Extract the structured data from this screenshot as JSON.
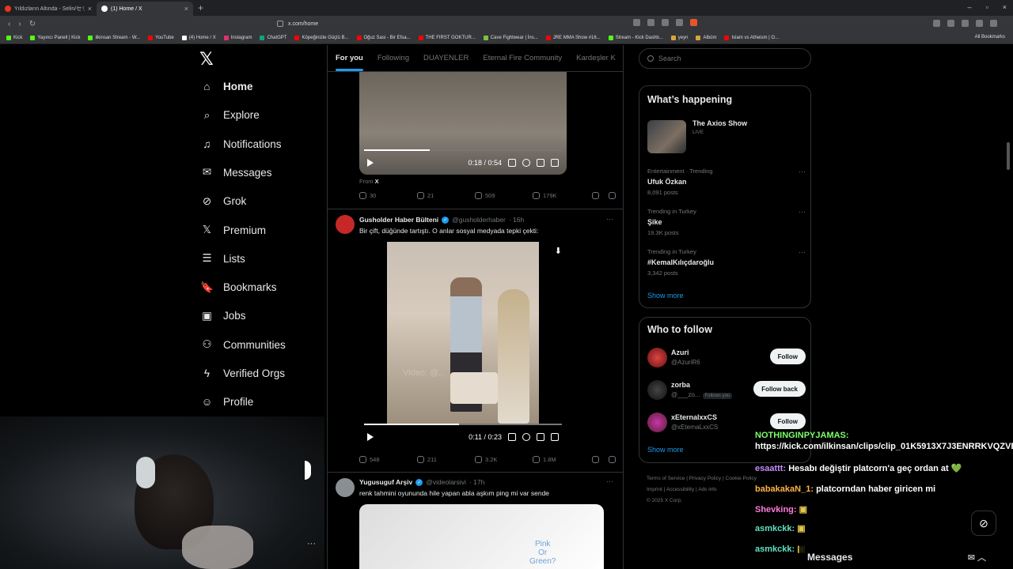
{
  "browser": {
    "tabs": [
      {
        "title": "Yıldızların Altında - Selin/セリン (cove...",
        "active": false
      },
      {
        "title": "(1) Home / X",
        "active": true
      }
    ],
    "url": "x.com/home",
    "bookmarks": [
      "Kick",
      "Yayıncı Paneli | Kick",
      "ilkinsan Stream - W...",
      "YouTube",
      "(4) Home / X",
      "Instagram",
      "ChatGPT",
      "Köpeğinizle Güçlü B...",
      "Oğuz Sasi - Bir Efsa...",
      "THE FIRST GOKTUR...",
      "Cave Fightwear | İns...",
      "JRE MMA Show #16...",
      "Stream - Kick Dashb...",
      "yeyn",
      "Albüm",
      "Islam vs Atheism | O..."
    ],
    "all_bookmarks": "All Bookmarks"
  },
  "nav": {
    "items": [
      "Home",
      "Explore",
      "Notifications",
      "Messages",
      "Grok",
      "Premium",
      "Lists",
      "Bookmarks",
      "Jobs",
      "Communities",
      "Verified Orgs",
      "Profile"
    ]
  },
  "feed": {
    "tabs": [
      "For you",
      "Following",
      "DUAYENLER",
      "Eternal Fire Community",
      "Kardeşler K"
    ],
    "tweet1": {
      "video_time": "0:18 / 0:54",
      "video_progress": 0.33,
      "from_label": "From",
      "from_source": "X",
      "replies": "30",
      "reposts": "21",
      "likes": "509",
      "views": "179K"
    },
    "tweet2": {
      "name": "Gusholder Haber Bülteni",
      "handle": "@gusholderhaber",
      "time": "· 16h",
      "text": "Bir çift, düğünde tartıştı. O anlar sosyal medyada tepki çekti:",
      "video_time": "0:11 / 0:23",
      "video_progress": 0.48,
      "watermark": "Video: @...",
      "replies": "548",
      "reposts": "211",
      "likes": "3.2K",
      "views": "1.8M"
    },
    "tweet3": {
      "name": "Yugusuguf Arşiv",
      "handle": "@videolarsivi",
      "time": "· 17h",
      "text": "renk tahmini oyununda hile yapan abla aşkım ping mi var sende",
      "overlay": "Pink\nOr\nGreen?"
    }
  },
  "right": {
    "search_placeholder": "Search",
    "happening_title": "What’s happening",
    "live": {
      "name": "The Axios Show",
      "status": "LIVE"
    },
    "trends": [
      {
        "meta": "Entertainment · Trending",
        "name": "Ufuk Özkan",
        "count": "8,091 posts"
      },
      {
        "meta": "Trending in Turkey",
        "name": "Şike",
        "count": "19.3K posts"
      },
      {
        "meta": "Trending in Turkey",
        "name": "#KemalKılıçdaroğlu",
        "count": "3,342 posts"
      }
    ],
    "show_more": "Show more",
    "who_title": "Who to follow",
    "who": [
      {
        "name": "Azuri",
        "handle": "@AzuriR6",
        "button": "Follow",
        "follows_you": ""
      },
      {
        "name": "zorba",
        "handle": "@___zo...",
        "button": "Follow back",
        "follows_you": "Follows you"
      },
      {
        "name": "xEternalxxCS",
        "handle": "@xEternaLxxCS",
        "button": "Follow",
        "follows_you": ""
      }
    ],
    "footer": [
      "Terms of Service",
      "Privacy Policy",
      "Cookie Policy",
      "Imprint",
      "Accessibility",
      "Ads info",
      "© 2025 X Corp."
    ]
  },
  "chat": [
    {
      "user": "NOTHINGINPYJAMAS:",
      "msg": "https://kick.com/ilkinsan/clips/clip_01K5913X7J3ENRRKVQZVB2XA13",
      "color": "#7dff6b"
    },
    {
      "user": "esaattt:",
      "msg": "Hesabı değiştir platcorn'a geç ordan at 💚",
      "color": "#c38cff"
    },
    {
      "user": "babakakaN_1:",
      "msg": "platcorndan haber giricen mi",
      "color": "#ffb347"
    },
    {
      "user": "Shevking:",
      "msg": "",
      "color": "#ff7ad9"
    },
    {
      "user": "asmkckk:",
      "msg": "",
      "color": "#60e0c0"
    },
    {
      "user": "asmkckk:",
      "msg": "",
      "color": "#60e0c0"
    }
  ],
  "messages_label": "Messages",
  "colors": {
    "accent": "#1d9bf0",
    "bg": "#000000",
    "border": "#2f3336"
  }
}
